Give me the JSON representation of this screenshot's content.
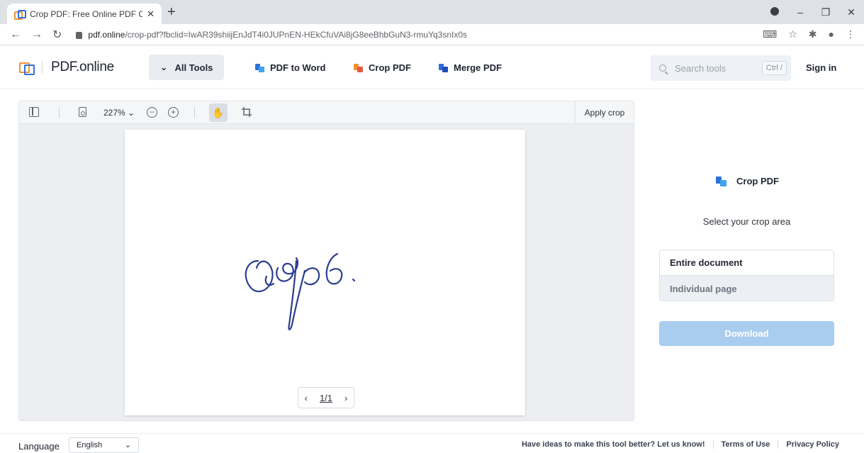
{
  "browser": {
    "tab_title": "Crop PDF: Free Online PDF Crop",
    "tab_close": "✕",
    "new_tab": "+",
    "url_host": "pdf.online",
    "url_path": "/crop-pdf?fbclid=IwAR39shiijEnJdT4i0JUPnEN-HEkCfuVAi8jG8eeBhbGuN3-rmuYq3snIx0s"
  },
  "header": {
    "logo_text": "PDF.online",
    "all_tools": "All Tools",
    "tools": [
      "PDF to Word",
      "Crop PDF",
      "Merge PDF"
    ],
    "search_placeholder": "Search tools",
    "search_shortcut": "Ctrl /",
    "sign_in": "Sign in"
  },
  "viewer": {
    "zoom": "227%",
    "apply_crop": "Apply crop",
    "page_indicator": "1/1",
    "prev": "‹",
    "next": "›"
  },
  "panel": {
    "title": "Crop PDF",
    "select_label": "Select your crop area",
    "options": [
      "Entire document",
      "Individual page"
    ],
    "download": "Download"
  },
  "footer": {
    "language_label": "Language",
    "language_value": "English",
    "links": [
      "Have ideas to make this tool better? Let us know!",
      "Terms of Use",
      "Privacy Policy"
    ]
  },
  "colors": {
    "accent_blue": "#2f6fe0",
    "accent_orange": "#f0913a",
    "download_disabled": "#a9cdef"
  }
}
